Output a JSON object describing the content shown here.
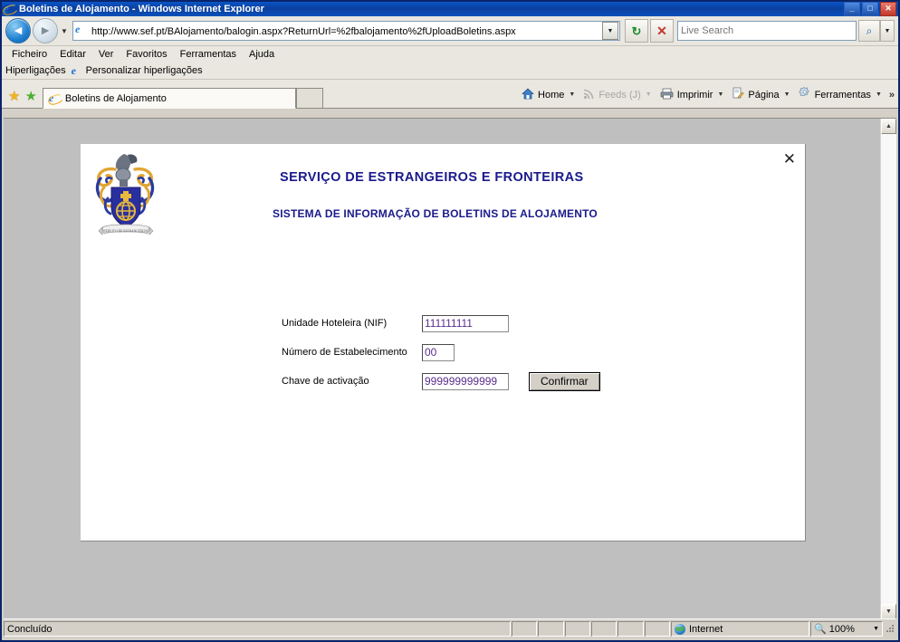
{
  "window": {
    "title": "Boletins de Alojamento - Windows Internet Explorer",
    "icon": "ie-logo-icon",
    "minimize_label": "_",
    "maximize_label": "□",
    "close_label": "✕"
  },
  "navbar": {
    "back_label": "◄",
    "forward_label": "►",
    "history_caret": "▼",
    "address_icon": "page-icon",
    "url": "http://www.sef.pt/BAlojamento/balogin.aspx?ReturnUrl=%2fbalojamento%2fUploadBoletins.aspx",
    "address_dropdown": "▼",
    "refresh_label": "↻",
    "stop_label": "✕",
    "search_placeholder": "Live Search",
    "search_value": "",
    "search_go": "⌕",
    "search_dropdown": "▼"
  },
  "menubar": {
    "items": [
      {
        "label": "Ficheiro"
      },
      {
        "label": "Editar"
      },
      {
        "label": "Ver"
      },
      {
        "label": "Favoritos"
      },
      {
        "label": "Ferramentas"
      },
      {
        "label": "Ajuda"
      }
    ]
  },
  "linksbar": {
    "label": "Hiperligações",
    "item_icon": "ie-logo-icon",
    "item_label": "Personalizar hiperligações"
  },
  "tabbar": {
    "favorites_star": "★",
    "add_favorite": "★",
    "tab_label": "Boletins de Alojamento",
    "tab_icon": "ie-logo-icon",
    "new_tab_label": "",
    "tools": [
      {
        "label": "Home",
        "icon": "home-icon",
        "dim": false,
        "caret": "▼"
      },
      {
        "label": "Feeds (J)",
        "icon": "feeds-icon",
        "dim": true,
        "caret": "▼"
      },
      {
        "label": "Imprimir",
        "icon": "printer-icon",
        "dim": false,
        "caret": "▼"
      },
      {
        "label": "Página",
        "icon": "page-edit-icon",
        "dim": false,
        "caret": "▼"
      },
      {
        "label": "Ferramentas",
        "icon": "gear-icon",
        "dim": false,
        "caret": "▼"
      }
    ],
    "overflow_label": "»"
  },
  "page": {
    "close_label": "✕",
    "crest_alt": "coat-of-arms-sef",
    "heading_main": "SERVIÇO DE ESTRANGEIROS E FRONTEIRAS",
    "heading_sub": "SISTEMA DE INFORMAÇÃO DE BOLETINS DE ALOJAMENTO",
    "heading_color": "#1a1a8c",
    "value_color": "#5b2d8e",
    "fields": [
      {
        "label": "Unidade Hoteleira (NIF)",
        "value": "111111111",
        "placeholder": ""
      },
      {
        "label": "Número de Estabelecimento",
        "value": "00",
        "placeholder": ""
      },
      {
        "label": "Chave de activação",
        "value": "999999999999",
        "placeholder": ""
      }
    ],
    "submit_label": "Confirmar"
  },
  "scrollbar": {
    "up_label": "▲",
    "down_label": "▼"
  },
  "statusbar": {
    "message": "Concluído",
    "zone_icon": "globe-icon",
    "zone_label": "Internet",
    "zoom_icon": "magnifier-icon",
    "zoom_label": "100%",
    "zoom_caret": "▼"
  }
}
